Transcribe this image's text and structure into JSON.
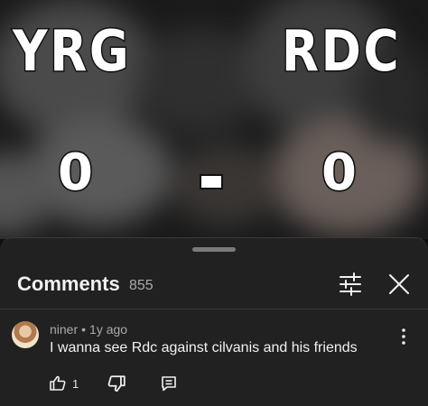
{
  "video": {
    "team_left": "YRG",
    "team_right": "RDC",
    "score_left": "0",
    "score_separator": "-",
    "score_right": "0"
  },
  "comments_panel": {
    "title": "Comments",
    "count": "855",
    "filter_icon": "sliders-icon",
    "close_icon": "close-icon"
  },
  "comments": [
    {
      "author": "niner",
      "separator": "•",
      "time": "1y ago",
      "text": "I wanna see Rdc against cilvanis and his friends",
      "like_count": "1",
      "icons": [
        "thumbs-up-icon",
        "thumbs-down-icon",
        "reply-icon",
        "more-vertical-icon"
      ]
    }
  ],
  "colors": {
    "background": "#0f0f0f",
    "sheet": "#212121",
    "text_primary": "#f1f1f1",
    "text_secondary": "#aaaaaa"
  }
}
